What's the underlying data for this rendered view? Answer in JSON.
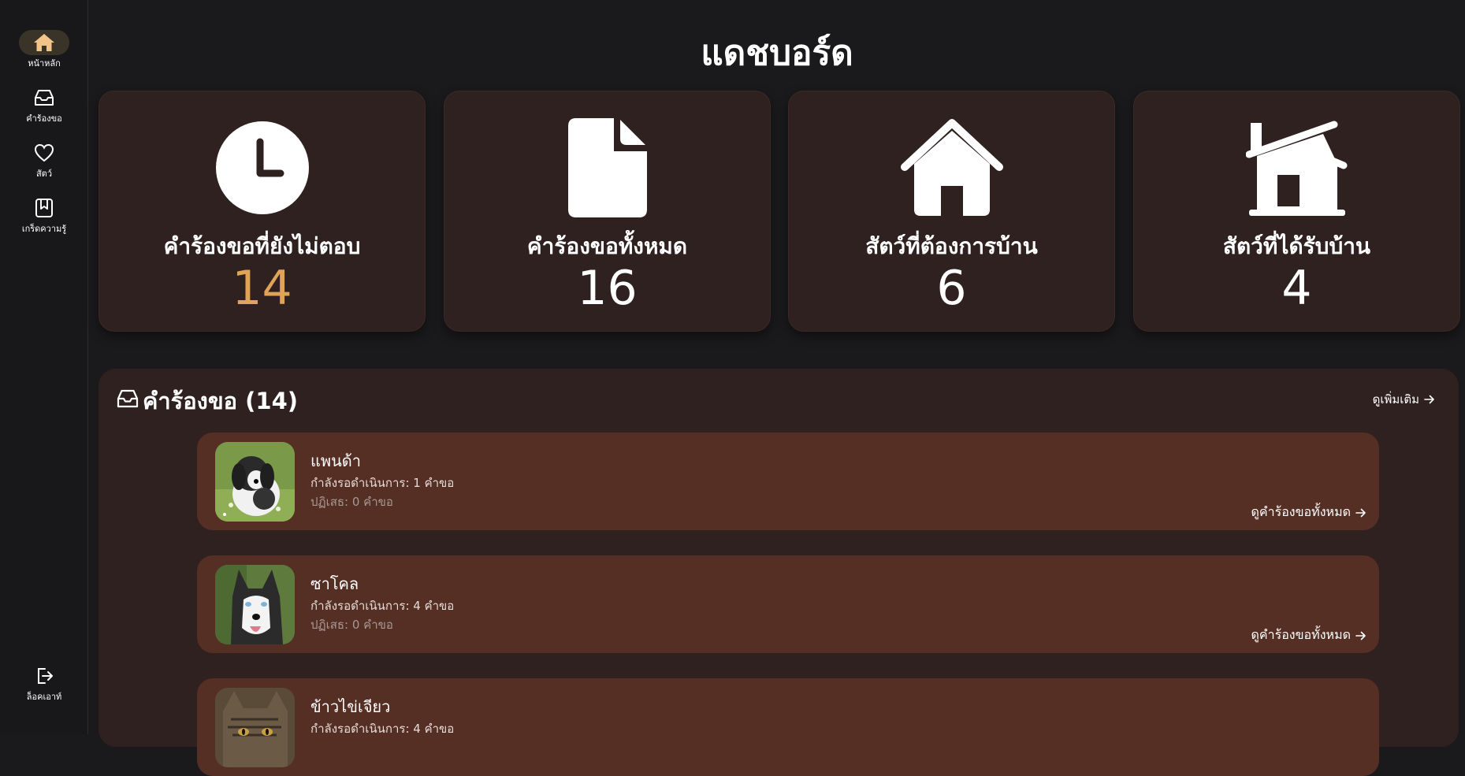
{
  "sidebar": {
    "items": [
      {
        "label": "หน้าหลัก",
        "icon": "home-icon",
        "active": true
      },
      {
        "label": "คำร้องขอ",
        "icon": "inbox-icon",
        "active": false
      },
      {
        "label": "สัตว์",
        "icon": "heart-icon",
        "active": false
      },
      {
        "label": "เกร็ดความรู้",
        "icon": "book-icon",
        "active": false
      }
    ],
    "logout_label": "ล็อคเอาท์"
  },
  "page": {
    "title": "แดชบอร์ด"
  },
  "stats": [
    {
      "title": "คำร้องขอที่ยังไม่ตอบ",
      "value": "14",
      "icon": "clock-icon",
      "accent": true
    },
    {
      "title": "คำร้องขอทั้งหมด",
      "value": "16",
      "icon": "document-icon",
      "accent": false
    },
    {
      "title": "สัตว์ที่ต้องการบ้าน",
      "value": "6",
      "icon": "house-icon",
      "accent": false
    },
    {
      "title": "สัตว์ที่ได้รับบ้าน",
      "value": "4",
      "icon": "house-chimney-icon",
      "accent": false
    }
  ],
  "requests": {
    "title": "คำร้องขอ (14)",
    "see_more": "ดูเพิ่มเติม",
    "items": [
      {
        "name": "แพนด้า",
        "pending": "กำลังรอดำเนินการ: 1 คำขอ",
        "rejected": "ปฏิเสธ: 0 คำขอ",
        "link": "ดูคำร้องขอทั้งหมด",
        "photo": "dog-photo"
      },
      {
        "name": "ซาโคล",
        "pending": "กำลังรอดำเนินการ: 4 คำขอ",
        "rejected": "ปฏิเสธ: 0 คำขอ",
        "link": "ดูคำร้องขอทั้งหมด",
        "photo": "husky-photo"
      },
      {
        "name": "ข้าวไข่เจียว",
        "pending": "กำลังรอดำเนินการ: 4 คำขอ",
        "rejected": "",
        "link": "",
        "photo": "cat-photo"
      }
    ]
  },
  "colors": {
    "background": "#1a1a1c",
    "card": "#2e211f",
    "request_item": "#552e24",
    "accent": "#e0a458",
    "active_nav": "#3a3328"
  }
}
